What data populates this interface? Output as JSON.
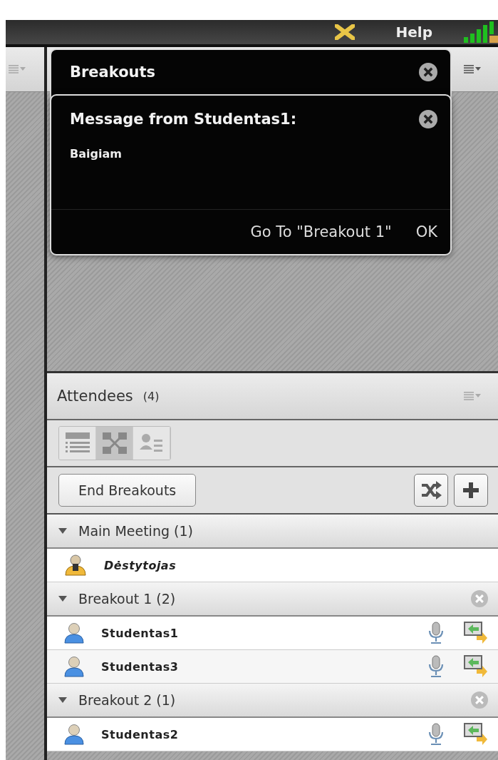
{
  "top_bar": {
    "help": "Help"
  },
  "breakouts_dialog": {
    "title": "Breakouts"
  },
  "message_dialog": {
    "title": "Message from Studentas1:",
    "message": "Baigiam",
    "buttons": [
      {
        "label": "Go To \"Breakout 1\""
      },
      {
        "label": "OK"
      }
    ]
  },
  "attendees": {
    "title": "Attendees",
    "count": "(4)",
    "view_modes": [
      {
        "kind": "list",
        "selected": false
      },
      {
        "kind": "breakout",
        "selected": true
      },
      {
        "kind": "presenter",
        "selected": false
      }
    ],
    "end_button": "End Breakouts",
    "groups": [
      {
        "name": "Main Meeting (1)",
        "expanded": true,
        "closable": false,
        "members": [
          {
            "name": "Dėstytojas",
            "kind": "host"
          }
        ]
      },
      {
        "name": "Breakout 1 (2)",
        "expanded": true,
        "closable": true,
        "members": [
          {
            "name": "Studentas1",
            "kind": "participant"
          },
          {
            "name": "Studentas3",
            "kind": "participant"
          }
        ]
      },
      {
        "name": "Breakout 2 (1)",
        "expanded": true,
        "closable": true,
        "members": [
          {
            "name": "Studentas2",
            "kind": "participant"
          }
        ]
      }
    ]
  }
}
